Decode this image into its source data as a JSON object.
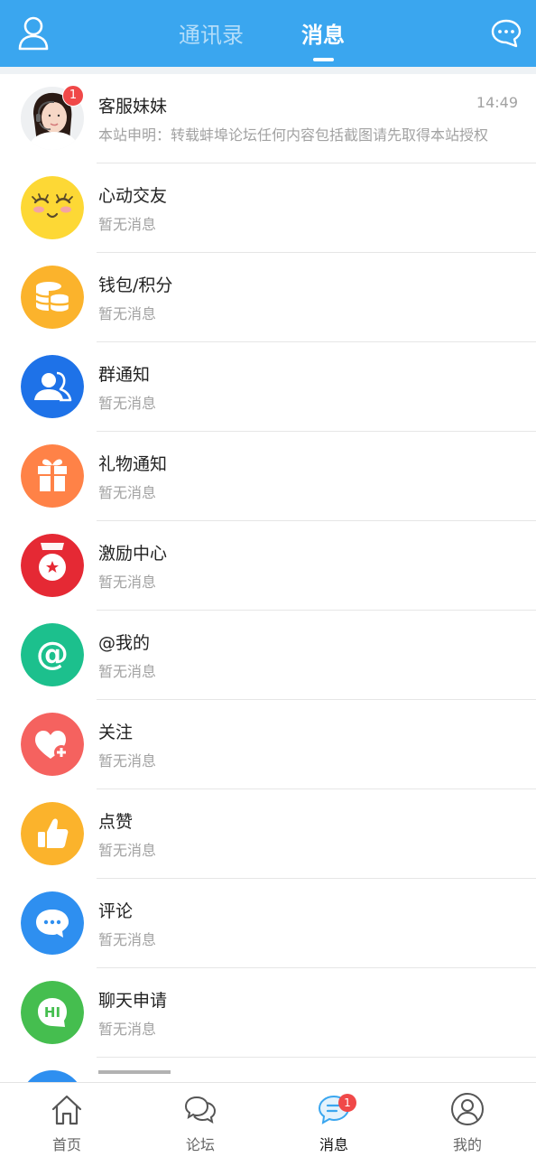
{
  "header": {
    "tabs": [
      {
        "label": "通讯录",
        "active": false
      },
      {
        "label": "消息",
        "active": true
      }
    ],
    "profile_icon": "user-outline-icon",
    "chat_icon": "chat-bubble-dots-icon"
  },
  "messages": [
    {
      "title": "客服妹妹",
      "subtitle": "本站申明：转载蚌埠论坛任何内容包括截图请先取得本站授权",
      "time": "14:49",
      "badge": "1",
      "icon": "service-avatar"
    },
    {
      "title": "心动交友",
      "subtitle": "暂无消息",
      "icon": "smile-face-icon",
      "color": "#fdd835"
    },
    {
      "title": "钱包/积分",
      "subtitle": "暂无消息",
      "icon": "coins-icon",
      "color": "#fbb32c"
    },
    {
      "title": "群通知",
      "subtitle": "暂无消息",
      "icon": "group-icon",
      "color": "#1e72e8"
    },
    {
      "title": "礼物通知",
      "subtitle": "暂无消息",
      "icon": "gift-icon",
      "color": "#ff8247"
    },
    {
      "title": "激励中心",
      "subtitle": "暂无消息",
      "icon": "incentive-icon",
      "color": "#e52934"
    },
    {
      "title": "@我的",
      "subtitle": "暂无消息",
      "icon": "at-icon",
      "color": "#1cc08d"
    },
    {
      "title": "关注",
      "subtitle": "暂无消息",
      "icon": "heart-plus-icon",
      "color": "#f5625f"
    },
    {
      "title": "点赞",
      "subtitle": "暂无消息",
      "icon": "thumbs-up-icon",
      "color": "#fbb32c"
    },
    {
      "title": "评论",
      "subtitle": "暂无消息",
      "icon": "comment-icon",
      "color": "#2e8ff0"
    },
    {
      "title": "聊天申请",
      "subtitle": "暂无消息",
      "icon": "hi-chat-icon",
      "color": "#45be4f"
    }
  ],
  "tabbar": [
    {
      "label": "首页",
      "icon": "home-icon"
    },
    {
      "label": "论坛",
      "icon": "forum-icon"
    },
    {
      "label": "消息",
      "icon": "message-icon",
      "badge": "1",
      "active": true
    },
    {
      "label": "我的",
      "icon": "profile-icon"
    }
  ],
  "colors": {
    "primary": "#3aa6ef",
    "badge": "#f04848"
  }
}
